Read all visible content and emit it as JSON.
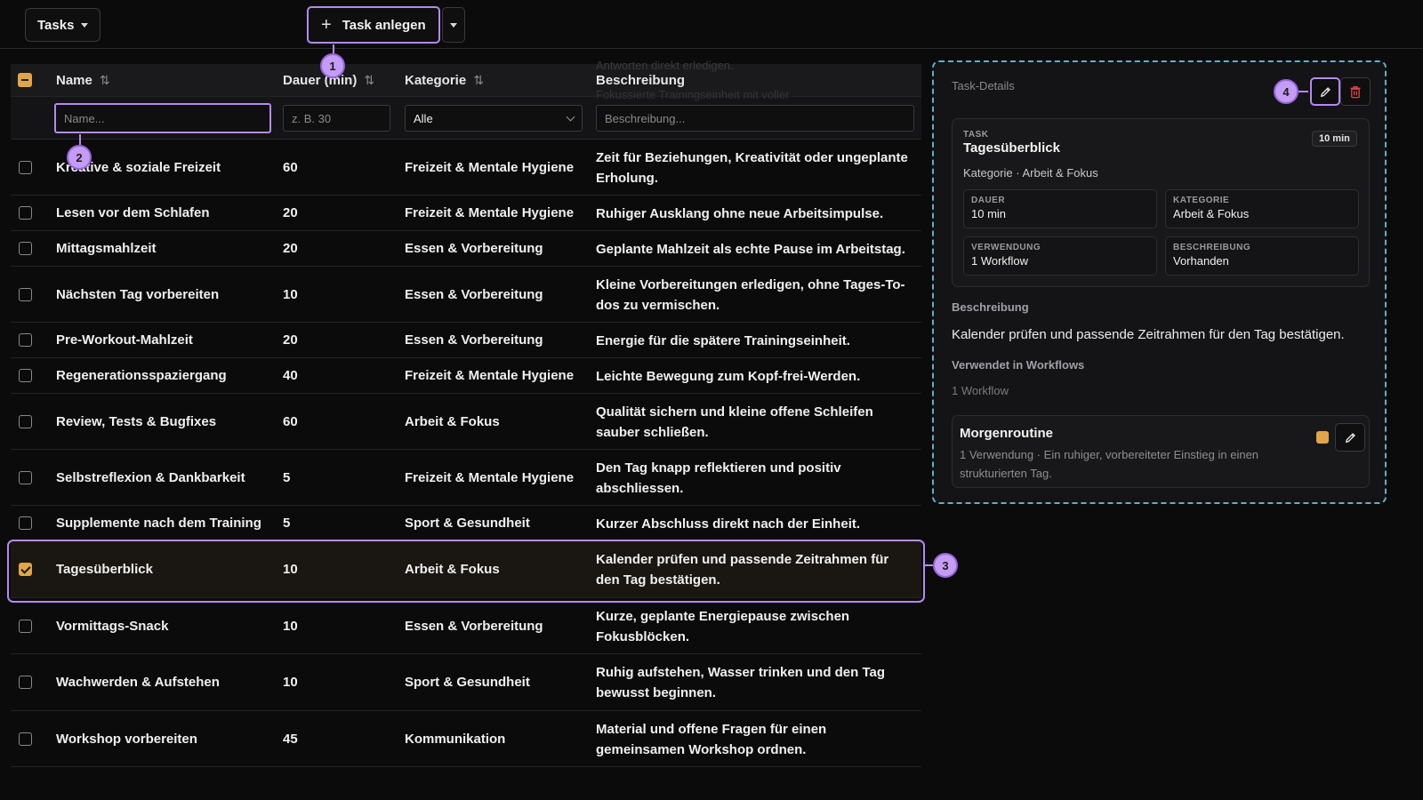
{
  "topbar": {
    "tasks_label": "Tasks",
    "create_label": "Task anlegen",
    "create_icon": "plus-icon"
  },
  "table": {
    "columns": {
      "name": "Name",
      "duration": "Dauer (min)",
      "category": "Kategorie",
      "description": "Beschreibung"
    },
    "ghost_text_1": "Antworten direkt erledigen.",
    "ghost_text_2": "Fokussierte Trainingseinheit mit voller",
    "filters": {
      "name_placeholder": "Name...",
      "duration_placeholder": "z. B. 30",
      "category_value": "Alle",
      "description_placeholder": "Beschreibung..."
    },
    "rows": [
      {
        "name": "Kreative & soziale Freizeit",
        "duration": "60",
        "category": "Freizeit & Mentale Hygiene",
        "description": "Zeit für Beziehungen, Kreativität oder ungeplante Erholung."
      },
      {
        "name": "Lesen vor dem Schlafen",
        "duration": "20",
        "category": "Freizeit & Mentale Hygiene",
        "description": "Ruhiger Ausklang ohne neue Arbeitsimpulse."
      },
      {
        "name": "Mittagsmahlzeit",
        "duration": "20",
        "category": "Essen & Vorbereitung",
        "description": "Geplante Mahlzeit als echte Pause im Arbeitstag."
      },
      {
        "name": "Nächsten Tag vorbereiten",
        "duration": "10",
        "category": "Essen & Vorbereitung",
        "description": "Kleine Vorbereitungen erledigen, ohne Tages-To-dos zu vermischen."
      },
      {
        "name": "Pre-Workout-Mahlzeit",
        "duration": "20",
        "category": "Essen & Vorbereitung",
        "description": "Energie für die spätere Trainingseinheit."
      },
      {
        "name": "Regenerationsspaziergang",
        "duration": "40",
        "category": "Freizeit & Mentale Hygiene",
        "description": "Leichte Bewegung zum Kopf-frei-Werden."
      },
      {
        "name": "Review, Tests & Bugfixes",
        "duration": "60",
        "category": "Arbeit & Fokus",
        "description": "Qualität sichern und kleine offene Schleifen sauber schließen."
      },
      {
        "name": "Selbstreflexion & Dankbarkeit",
        "duration": "5",
        "category": "Freizeit & Mentale Hygiene",
        "description": "Den Tag knapp reflektieren und positiv abschliessen."
      },
      {
        "name": "Supplemente nach dem Training",
        "duration": "5",
        "category": "Sport & Gesundheit",
        "description": "Kurzer Abschluss direkt nach der Einheit."
      },
      {
        "name": "Tagesüberblick",
        "duration": "10",
        "category": "Arbeit & Fokus",
        "description": "Kalender prüfen und passende Zeitrahmen für den Tag bestätigen."
      },
      {
        "name": "Vormittags-Snack",
        "duration": "10",
        "category": "Essen & Vorbereitung",
        "description": "Kurze, geplante Energiepause zwischen Fokusblöcken."
      },
      {
        "name": "Wachwerden & Aufstehen",
        "duration": "10",
        "category": "Sport & Gesundheit",
        "description": "Ruhig aufstehen, Wasser trinken und den Tag bewusst beginnen."
      },
      {
        "name": "Workshop vorbereiten",
        "duration": "45",
        "category": "Kommunikation",
        "description": "Material und offene Fragen für einen gemeinsamen Workshop ordnen."
      }
    ]
  },
  "details": {
    "panel_label": "Task-Details",
    "task_caption": "TASK",
    "task_title": "Tagesüberblick",
    "task_subtitle": "Kategorie · Arbeit & Fokus",
    "duration_badge": "10 min",
    "stats": {
      "dauer_label": "DAUER",
      "dauer_value": "10 min",
      "kategorie_label": "KATEGORIE",
      "kategorie_value": "Arbeit & Fokus",
      "verwendung_label": "VERWENDUNG",
      "verwendung_value": "1 Workflow",
      "beschreibung_label": "BESCHREIBUNG",
      "beschreibung_value": "Vorhanden"
    },
    "description_heading": "Beschreibung",
    "description_text": "Kalender prüfen und passende Zeitrahmen für den Tag bestätigen.",
    "workflows_heading": "Verwendet in Workflows",
    "workflows_count": "1 Workflow",
    "workflow": {
      "title": "Morgenroutine",
      "subtitle": "1 Verwendung · Ein ruhiger, vorbereiteter Einstieg in einen strukturierten Tag.",
      "color": "#e0a648"
    }
  },
  "callouts": [
    "1",
    "2",
    "3",
    "4"
  ],
  "colors": {
    "accent": "#b58af0",
    "checkbox": "#e0a648",
    "panel_border": "#5fb0c8",
    "delete": "#e0424a"
  }
}
